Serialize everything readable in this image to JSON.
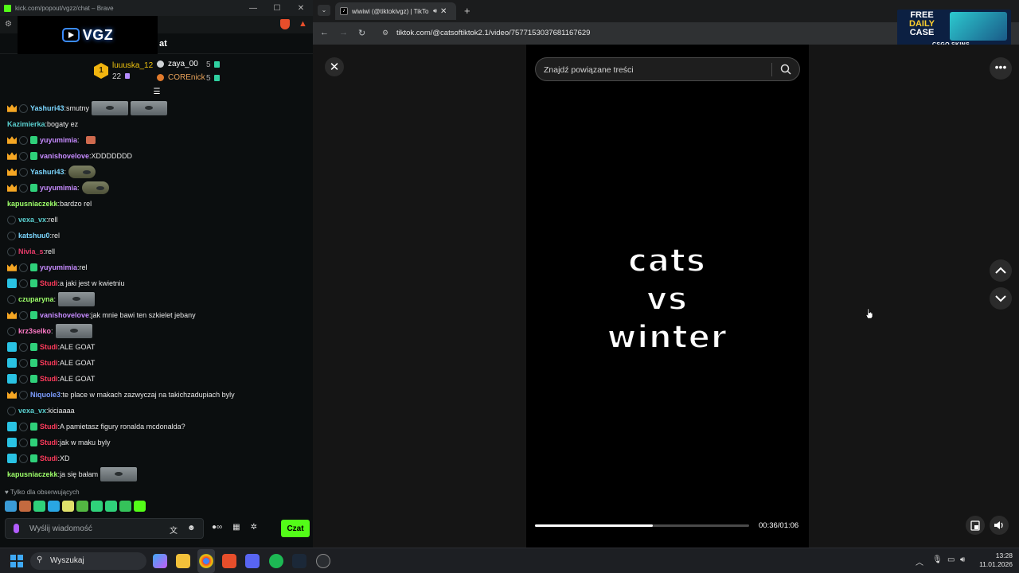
{
  "left_window": {
    "title": "kick.com/popout/vgzz/chat – Brave",
    "chat_header_label": "at",
    "vgz_logo": "VGZ",
    "leaderboard": {
      "first": {
        "rank": "1",
        "name": "luuuska_12",
        "count": "22"
      },
      "second": {
        "name": "zaya_00",
        "count": "5"
      },
      "third": {
        "name": "COREnick",
        "count": "5"
      }
    },
    "messages": [
      {
        "badges": [
          "crown",
          "ring"
        ],
        "user": "Yashuri43",
        "color": "#7cd7ff",
        "text": "smutny",
        "emotes": [
          "face",
          "face"
        ]
      },
      {
        "badges": [],
        "user": "Kazimierka",
        "color": "#5ad0d0",
        "text": "bogaty ez",
        "emotes": []
      },
      {
        "badges": [
          "crown",
          "ring",
          "sub"
        ],
        "user": "yuyumimia",
        "color": "#c78bff",
        "text": "",
        "emotes": [
          "tiny"
        ]
      },
      {
        "badges": [
          "crown",
          "ring",
          "sub"
        ],
        "user": "vanishovelove",
        "color": "#c78bff",
        "text": "XDDDDDDD",
        "emotes": []
      },
      {
        "badges": [
          "crown",
          "ring"
        ],
        "user": "Yashuri43",
        "color": "#7cd7ff",
        "text": "",
        "emotes": [
          "small"
        ]
      },
      {
        "badges": [
          "crown",
          "ring",
          "sub"
        ],
        "user": "yuyumimia",
        "color": "#c78bff",
        "text": "",
        "emotes": [
          "small"
        ]
      },
      {
        "badges": [],
        "user": "kapusniaczekk",
        "color": "#9eff6a",
        "text": "bardzo rel",
        "emotes": []
      },
      {
        "badges": [
          "ring"
        ],
        "user": "vexa_vx",
        "color": "#5ad0d0",
        "text": "rell",
        "emotes": []
      },
      {
        "badges": [
          "ring"
        ],
        "user": "katshuu0",
        "color": "#7cd7ff",
        "text": "rel",
        "emotes": []
      },
      {
        "badges": [
          "ring"
        ],
        "user": "Nivia_s",
        "color": "#e83b6a",
        "text": "rell",
        "emotes": []
      },
      {
        "badges": [
          "crown",
          "ring",
          "sub"
        ],
        "user": "yuyumimia",
        "color": "#c78bff",
        "text": "rel",
        "emotes": []
      },
      {
        "badges": [
          "gift",
          "ring",
          "sub"
        ],
        "user": "Studi",
        "color": "#ff3b5c",
        "text": "a jaki jest w kwietniu",
        "emotes": []
      },
      {
        "badges": [
          "ring"
        ],
        "user": "czuparyna",
        "color": "#9eff6a",
        "text": "",
        "emotes": [
          "face"
        ]
      },
      {
        "badges": [
          "crown",
          "ring",
          "sub"
        ],
        "user": "vanishovelove",
        "color": "#c78bff",
        "text": "jak mnie bawi ten szkielet jebany",
        "emotes": []
      },
      {
        "badges": [
          "ring"
        ],
        "user": "krz3selko",
        "color": "#ff7ac7",
        "text": "",
        "emotes": [
          "face"
        ]
      },
      {
        "badges": [
          "gift",
          "ring",
          "sub"
        ],
        "user": "Studi",
        "color": "#ff3b5c",
        "text": "ALE GOAT",
        "emotes": []
      },
      {
        "badges": [
          "gift",
          "ring",
          "sub"
        ],
        "user": "Studi",
        "color": "#ff3b5c",
        "text": "ALE GOAT",
        "emotes": []
      },
      {
        "badges": [
          "gift",
          "ring",
          "sub"
        ],
        "user": "Studi",
        "color": "#ff3b5c",
        "text": "ALE GOAT",
        "emotes": []
      },
      {
        "badges": [
          "crown",
          "ring"
        ],
        "user": "Niquole3",
        "color": "#7c9dff",
        "text": "te place w makach zazwyczaj na takichzadupiach byly",
        "emotes": []
      },
      {
        "badges": [
          "ring"
        ],
        "user": "vexa_vx",
        "color": "#5ad0d0",
        "text": "kiciaaaa",
        "emotes": []
      },
      {
        "badges": [
          "gift",
          "ring",
          "sub"
        ],
        "user": "Studi",
        "color": "#ff3b5c",
        "text": "A pamietasz figury ronalda mcdonalda?",
        "emotes": []
      },
      {
        "badges": [
          "gift",
          "ring",
          "sub"
        ],
        "user": "Studi",
        "color": "#ff3b5c",
        "text": "jak w maku byly",
        "emotes": []
      },
      {
        "badges": [
          "gift",
          "ring",
          "sub"
        ],
        "user": "Studi",
        "color": "#ff3b5c",
        "text": "XD",
        "emotes": []
      },
      {
        "badges": [],
        "user": "kapusniaczekk",
        "color": "#9eff6a",
        "text": "ja się bałam",
        "emotes": [
          "face"
        ]
      }
    ],
    "followers_only": "Tylko dla obserwujących",
    "input_placeholder": "Wyślij wiadomość",
    "send_label": "Czat"
  },
  "right_window": {
    "tab_title": "wiwiwi (@tiktokivgz) | TikTo",
    "url": "tiktok.com/@catsoftiktok2.1/video/7577153037681167629",
    "search_placeholder": "Znajdź powiązane treści",
    "overlay_lines": [
      "cats",
      "vs",
      "winter"
    ],
    "time": "00:36/01:06",
    "progress": 0.55,
    "ad": {
      "line1": "FREE",
      "line2": "DAILY",
      "line3": "CASE",
      "brand": "CSGO SKINS"
    }
  },
  "taskbar": {
    "search_label": "Wyszukaj",
    "time": "13:28",
    "date": "11.01.2026"
  },
  "colors": {
    "kick_green": "#53fc18",
    "brave_orange": "#e74e2b"
  }
}
